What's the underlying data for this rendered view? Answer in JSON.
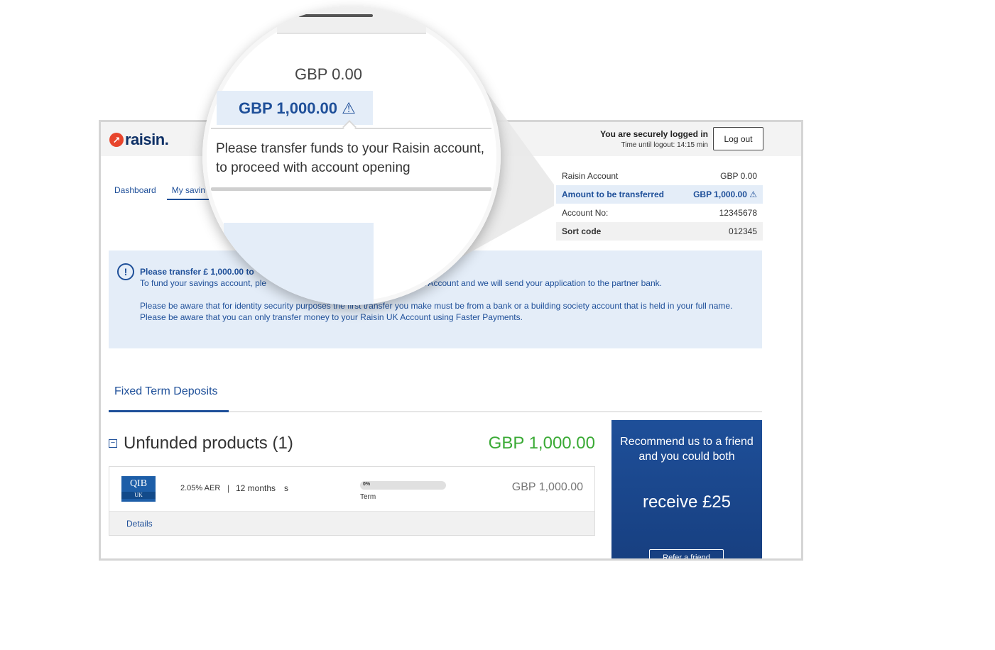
{
  "header": {
    "logo_text": "raisin.",
    "login_title": "You are securely logged in",
    "login_time": "Time until logout: 14:15 min",
    "logout_label": "Log out"
  },
  "nav": {
    "items": [
      {
        "label": "Dashboard"
      },
      {
        "label": "My savin"
      }
    ]
  },
  "account": {
    "rows": [
      {
        "label": "Raisin Account",
        "value": "GBP 0.00"
      },
      {
        "label": "Amount to be transferred",
        "value": "GBP 1,000.00 ⚠"
      },
      {
        "label": "Account No:",
        "value": "12345678"
      },
      {
        "label": "Sort code",
        "value": "012345"
      }
    ]
  },
  "banner": {
    "icon": "!",
    "title": "Please transfer £ 1,000.00 to",
    "line1_start": "To fund your savings account, ple",
    "line1_end": "UK Account and we will send your application to the partner bank.",
    "para2": "Please be aware that for identity security purposes the first transfer you make must be from a bank or a building society account that is held in your full name. Please be aware that you can only transfer money to your Raisin UK Account using Faster Payments."
  },
  "tabs": {
    "fixed_term": "Fixed Term Deposits"
  },
  "unfunded": {
    "collapse_icon": "−",
    "title": "Unfunded products (1)",
    "total": "GBP 1,000.00",
    "product": {
      "bank_logo_main": "QIB",
      "bank_logo_sub": "UK",
      "rate": "2.05% AER",
      "separator": "|",
      "term": "12 months",
      "suffix": "s",
      "progress_label": "0%",
      "progress_percent": 0,
      "term_label": "Term",
      "amount": "GBP 1,000.00",
      "details_label": "Details"
    }
  },
  "referral": {
    "line1": "Recommend us to a friend and you could both",
    "line2": "receive £25",
    "button": "Refer a friend"
  },
  "magnifier": {
    "balance": "GBP 0.00",
    "highlight": "GBP 1,000.00 ⚠",
    "tooltip": "Please transfer funds to your Raisin account, to proceed with account opening"
  },
  "colors": {
    "brand_blue": "#1e4f99",
    "brand_orange": "#e8452c",
    "success_green": "#3aaa35",
    "highlight_bg": "#e4edf8"
  }
}
